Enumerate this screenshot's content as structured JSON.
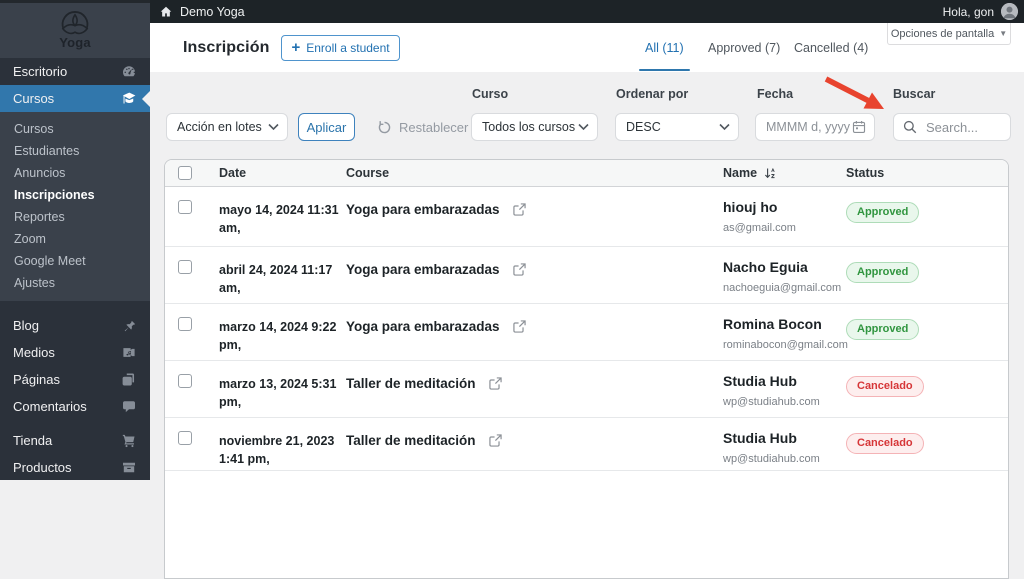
{
  "colors": {
    "accent_blue": "#2271b1",
    "sidebar_active_blue": "#3177ac",
    "approved_green": "#30953f",
    "cancelled_red": "#d63638",
    "annotation_red": "#e8432e"
  },
  "adminbar": {
    "site_name": "Demo Yoga",
    "greeting": "Hola, gon"
  },
  "sidebar": {
    "logo_text": "Yoga",
    "items_top": [
      {
        "label": "Escritorio",
        "icon": "dashboard-icon"
      },
      {
        "label": "Cursos",
        "icon": "graduation-cap-icon",
        "active": true
      }
    ],
    "submenu": [
      {
        "label": "Cursos"
      },
      {
        "label": "Estudiantes"
      },
      {
        "label": "Anuncios"
      },
      {
        "label": "Inscripciones",
        "active": true
      },
      {
        "label": "Reportes"
      },
      {
        "label": "Zoom"
      },
      {
        "label": "Google Meet"
      },
      {
        "label": "Ajustes"
      }
    ],
    "items_middle": [
      {
        "label": "Blog",
        "icon": "pushpin-icon"
      },
      {
        "label": "Medios",
        "icon": "media-icon"
      },
      {
        "label": "Páginas",
        "icon": "pages-icon"
      },
      {
        "label": "Comentarios",
        "icon": "comments-icon"
      }
    ],
    "items_bottom": [
      {
        "label": "Tienda",
        "icon": "cart-icon"
      },
      {
        "label": "Productos",
        "icon": "products-icon"
      }
    ]
  },
  "header": {
    "title": "Inscripción",
    "enroll_button": "Enroll a student",
    "screen_options": "Opciones de pantalla",
    "tabs": [
      {
        "label": "All (11)",
        "active": true
      },
      {
        "label": "Approved (7)"
      },
      {
        "label": "Cancelled (4)"
      }
    ]
  },
  "filters": {
    "bulk_action_value": "Acción en lotes",
    "apply_label": "Aplicar",
    "reset_label": "Restablecer",
    "course_label": "Curso",
    "course_value": "Todos los cursos",
    "order_label": "Ordenar por",
    "order_value": "DESC",
    "date_label": "Fecha",
    "date_placeholder": "MMMM d, yyyy",
    "search_label": "Buscar",
    "search_placeholder": "Search..."
  },
  "table": {
    "columns": {
      "date": "Date",
      "course": "Course",
      "name": "Name",
      "status": "Status"
    },
    "rows": [
      {
        "date1": "mayo 14, 2024 11:31",
        "date2": "am,",
        "course": "Yoga para embarazadas",
        "name": "hiouj ho",
        "email": "as@gmail.com",
        "status": "Approved",
        "status_type": "approved"
      },
      {
        "date1": "abril 24, 2024 11:17",
        "date2": "am,",
        "course": "Yoga para embarazadas",
        "name": "Nacho Eguia",
        "email": "nachoeguia@gmail.com",
        "status": "Approved",
        "status_type": "approved"
      },
      {
        "date1": "marzo 14, 2024 9:22",
        "date2": "pm,",
        "course": "Yoga para embarazadas",
        "name": "Romina Bocon",
        "email": "rominabocon@gmail.com",
        "status": "Approved",
        "status_type": "approved"
      },
      {
        "date1": "marzo 13, 2024 5:31",
        "date2": "pm,",
        "course": "Taller de meditación",
        "name": "Studia Hub",
        "email": "wp@studiahub.com",
        "status": "Cancelado",
        "status_type": "cancelled"
      },
      {
        "date1": "noviembre 21, 2023",
        "date2": "1:41 pm,",
        "course": "Taller de meditación",
        "name": "Studia Hub",
        "email": "wp@studiahub.com",
        "status": "Cancelado",
        "status_type": "cancelled"
      }
    ]
  }
}
